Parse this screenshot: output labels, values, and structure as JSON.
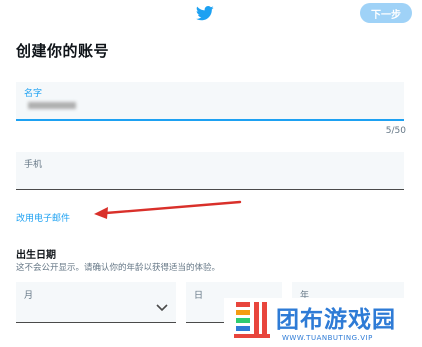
{
  "header": {
    "logo_icon": "twitter-bird-icon",
    "next_label": "下一步",
    "accent": "#1da1f2"
  },
  "page": {
    "title": "创建你的账号"
  },
  "form": {
    "name_label": "名字",
    "name_counter": "5/50",
    "phone_label": "手机",
    "use_email_link": "改用电子邮件"
  },
  "birth": {
    "title": "出生日期",
    "description": "这不会公开显示。请确认你的年龄以获得适当的体验。",
    "month_label": "月",
    "day_label": "日",
    "year_label": "年"
  },
  "watermark": {
    "text": "团布游戏园",
    "url": "WWW.TUANBUTING.VIP"
  }
}
